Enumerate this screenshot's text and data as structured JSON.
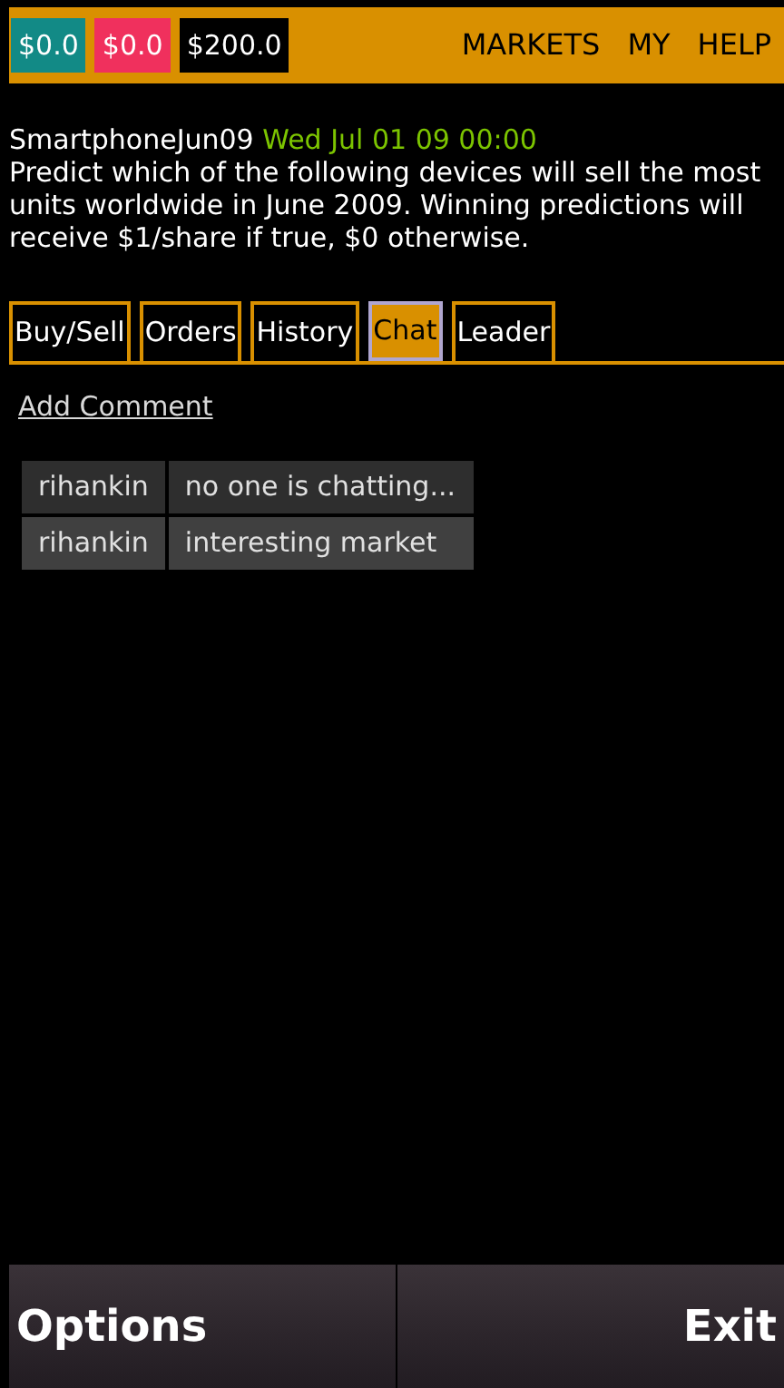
{
  "balances": [
    {
      "text": "$0.0",
      "color": "#128a86"
    },
    {
      "text": "$0.0",
      "color": "#f0305d"
    },
    {
      "text": "$200.0",
      "color": "#000000"
    }
  ],
  "nav": [
    "MARKETS",
    "MY",
    "HELP"
  ],
  "market": {
    "name": "SmartphoneJun09",
    "date": "Wed Jul 01 09 00:00",
    "description": "Predict which of the following devices will sell the most units worldwide in June 2009. Winning predictions will receive $1/share if true, $0 otherwise."
  },
  "tabs": [
    {
      "label": "Buy/Sell",
      "selected": false
    },
    {
      "label": "Orders",
      "selected": false
    },
    {
      "label": "History",
      "selected": false
    },
    {
      "label": "Chat",
      "selected": true
    },
    {
      "label": "Leader",
      "selected": false
    }
  ],
  "add_comment": "Add Comment",
  "comments": [
    {
      "user": "rihankin",
      "text": "no one is chatting..."
    },
    {
      "user": "rihankin",
      "text": "interesting market"
    }
  ],
  "softkeys": {
    "left": "Options",
    "right": "Exit"
  }
}
